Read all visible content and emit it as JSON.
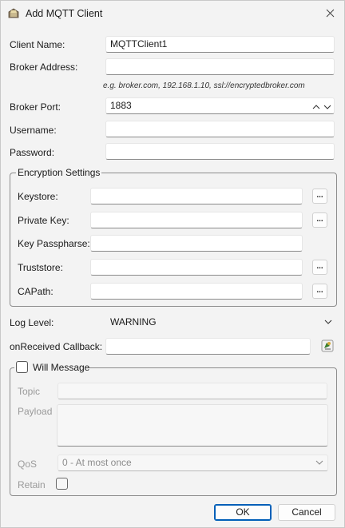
{
  "window": {
    "title": "Add MQTT Client"
  },
  "fields": {
    "client_name": {
      "label": "Client Name:",
      "value": "MQTTClient1"
    },
    "broker_address": {
      "label": "Broker Address:",
      "value": "",
      "hint": "e.g. broker.com, 192.168.1.10, ssl://encryptedbroker.com"
    },
    "broker_port": {
      "label": "Broker Port:",
      "value": "1883"
    },
    "username": {
      "label": "Username:",
      "value": ""
    },
    "password": {
      "label": "Password:",
      "value": ""
    }
  },
  "encryption": {
    "title": "Encryption Settings",
    "keystore": {
      "label": "Keystore:",
      "value": ""
    },
    "private_key": {
      "label": "Private Key:",
      "value": ""
    },
    "key_passphrase": {
      "label": "Key Passpharse:",
      "value": ""
    },
    "truststore": {
      "label": "Truststore:",
      "value": ""
    },
    "capath": {
      "label": "CAPath:",
      "value": ""
    },
    "browse_label": "..."
  },
  "log_level": {
    "label": "Log Level:",
    "value": "WARNING"
  },
  "callback": {
    "label": "onReceived Callback:",
    "value": ""
  },
  "will": {
    "title": "Will Message",
    "checked": false,
    "topic": {
      "label": "Topic",
      "value": ""
    },
    "payload": {
      "label": "Payload",
      "value": ""
    },
    "qos": {
      "label": "QoS",
      "value": "0 - At most once"
    },
    "retain": {
      "label": "Retain",
      "checked": false
    }
  },
  "buttons": {
    "ok": "OK",
    "cancel": "Cancel"
  }
}
